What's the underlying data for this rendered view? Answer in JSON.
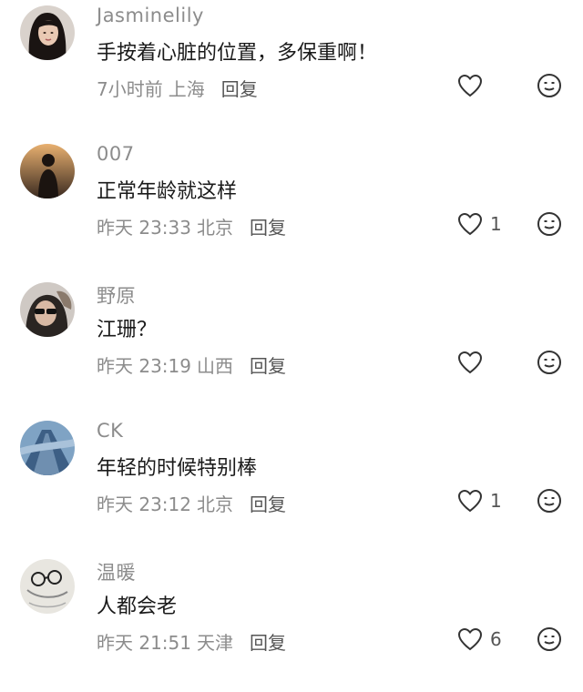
{
  "comments": [
    {
      "username": "Jasminelily",
      "text": "手按着心脏的位置，多保重啊！",
      "time": "7小时前",
      "location": "上海",
      "reply_label": "回复",
      "like_count": "",
      "avatar": "woman-portrait"
    },
    {
      "username": "007",
      "text": "正常年龄就这样",
      "time": "昨天 23:33",
      "location": "北京",
      "reply_label": "回复",
      "like_count": "1",
      "avatar": "silhouette-sunset"
    },
    {
      "username": "野原",
      "text": "江珊？",
      "time": "昨天 23:19",
      "location": "山西",
      "reply_label": "回复",
      "like_count": "",
      "avatar": "sunglasses-person"
    },
    {
      "username": "CK",
      "text": "年轻的时候特别棒",
      "time": "昨天 23:12",
      "location": "北京",
      "reply_label": "回复",
      "like_count": "1",
      "avatar": "blue-road"
    },
    {
      "username": "温暖",
      "text": "人都会老",
      "time": "昨天 21:51",
      "location": "天津",
      "reply_label": "回复",
      "like_count": "6",
      "avatar": "glasses-sketch"
    }
  ],
  "colors": {
    "username": "#8c8c8c",
    "text": "#1a1a1a",
    "meta": "#8c8c8c",
    "icon": "#333333"
  }
}
